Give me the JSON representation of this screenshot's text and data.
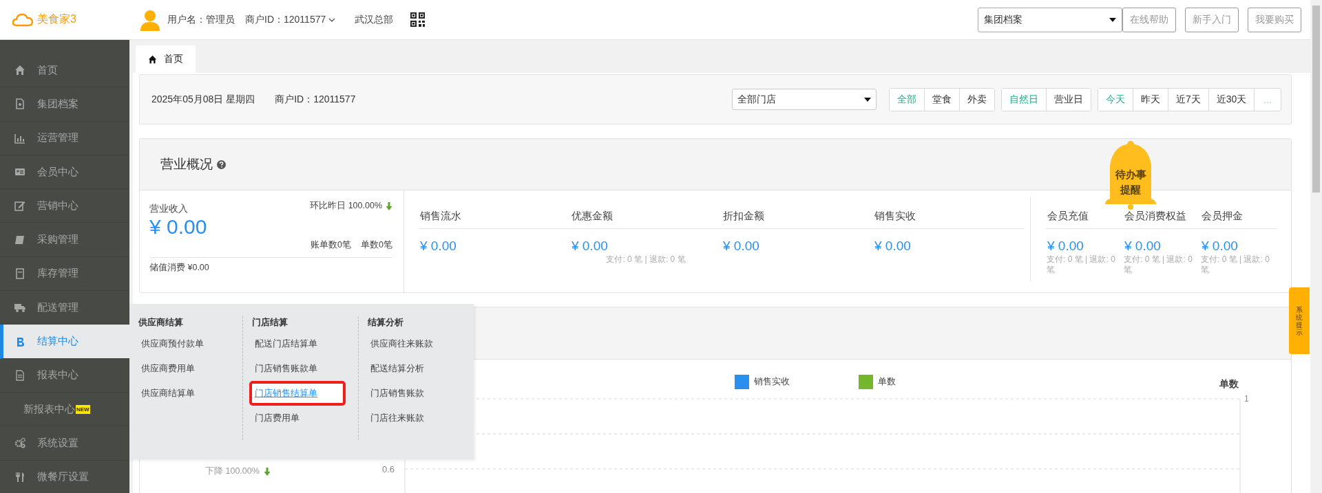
{
  "header": {
    "logo": "美食家3",
    "username": "用户名：管理员",
    "merchant": "商户ID：12011577",
    "store": "武汉总部",
    "archive_select": "集团档案",
    "buttons": [
      "在线帮助",
      "新手入门",
      "我要购买"
    ]
  },
  "sidebar": {
    "items": [
      {
        "label": "首页",
        "selected": false
      },
      {
        "label": "集团档案",
        "selected": false
      },
      {
        "label": "运营管理",
        "selected": false
      },
      {
        "label": "会员中心",
        "selected": false
      },
      {
        "label": "营销中心",
        "selected": false
      },
      {
        "label": "采购管理",
        "selected": false
      },
      {
        "label": "库存管理",
        "selected": false
      },
      {
        "label": "配送管理",
        "selected": false
      },
      {
        "label": "结算中心",
        "selected": true
      },
      {
        "label": "报表中心",
        "selected": false
      },
      {
        "label": "新报表中心",
        "badge": "NEW",
        "selected": false
      },
      {
        "label": "系统设置",
        "selected": false
      },
      {
        "label": "微餐厅设置",
        "selected": false
      }
    ]
  },
  "tabs": [
    {
      "label": "首页",
      "selected": true
    }
  ],
  "filter": {
    "date": "2025年05月08日 星期四",
    "merchant": "商户ID：12011577",
    "store_select": "全部门店",
    "groups": [
      {
        "options": [
          {
            "label": "全部",
            "selected": true
          },
          {
            "label": "堂食",
            "selected": false
          },
          {
            "label": "外卖",
            "selected": false
          }
        ]
      },
      {
        "options": [
          {
            "label": "自然日",
            "selected": true
          },
          {
            "label": "营业日",
            "selected": false
          }
        ]
      },
      {
        "options": [
          {
            "label": "今天",
            "selected": true
          },
          {
            "label": "昨天",
            "selected": false
          },
          {
            "label": "近7天",
            "selected": false
          },
          {
            "label": "近30天",
            "selected": false
          }
        ],
        "more": "..."
      }
    ]
  },
  "overview": {
    "title": "营业概况",
    "revenue": {
      "label": "营业收入",
      "compare": "环比昨日 100.00%",
      "value": "¥ 0.00",
      "bills": "账单数0笔",
      "orders": "单数0笔",
      "stored": "储值消费 ¥0.00"
    },
    "sales": [
      {
        "label": "销售流水",
        "value": "¥ 0.00"
      },
      {
        "label": "优惠金额",
        "value": "¥ 0.00",
        "note": "支付: 0 笔 | 退款: 0 笔"
      },
      {
        "label": "折扣金额",
        "value": "¥ 0.00"
      },
      {
        "label": "销售实收",
        "value": "¥ 0.00"
      }
    ],
    "members": [
      {
        "label": "会员充值",
        "value": "¥ 0.00",
        "note": "支付: 0 笔 | 退款: 0 笔"
      },
      {
        "label": "会员消费权益",
        "value": "¥ 0.00",
        "note": "支付: 0 笔 | 退款: 0 笔"
      },
      {
        "label": "会员押金",
        "value": "¥ 0.00",
        "note": "支付: 0 笔 | 退款: 0 笔"
      }
    ]
  },
  "todo_bell": {
    "text": "待办事提醒"
  },
  "side_tab": {
    "text": "系统提示"
  },
  "chart": {
    "legend": [
      {
        "label": "销售实收",
        "color": "#2b8ff0"
      },
      {
        "label": "单数",
        "color": "#76b52e"
      }
    ],
    "right_axis_title": "单数",
    "right_ticks": [
      "1"
    ],
    "left_ticks": [
      "0.6"
    ],
    "change": "下降 100.00%"
  },
  "menu": {
    "columns": [
      {
        "title": "供应商结算",
        "items": [
          {
            "label": "供应商预付款单",
            "selected": false
          },
          {
            "label": "供应商费用单",
            "selected": false
          },
          {
            "label": "供应商结算单",
            "selected": false
          }
        ]
      },
      {
        "title": "门店结算",
        "items": [
          {
            "label": "配送门店结算单",
            "selected": false
          },
          {
            "label": "门店销售账款单",
            "selected": false
          },
          {
            "label": "门店销售结算单",
            "selected": true
          },
          {
            "label": "门店费用单",
            "selected": false
          }
        ]
      },
      {
        "title": "结算分析",
        "items": [
          {
            "label": "供应商往来账款",
            "selected": false
          },
          {
            "label": "配送结算分析",
            "selected": false
          },
          {
            "label": "门店销售账款",
            "selected": false
          },
          {
            "label": "门店往来账款",
            "selected": false
          }
        ]
      }
    ]
  }
}
